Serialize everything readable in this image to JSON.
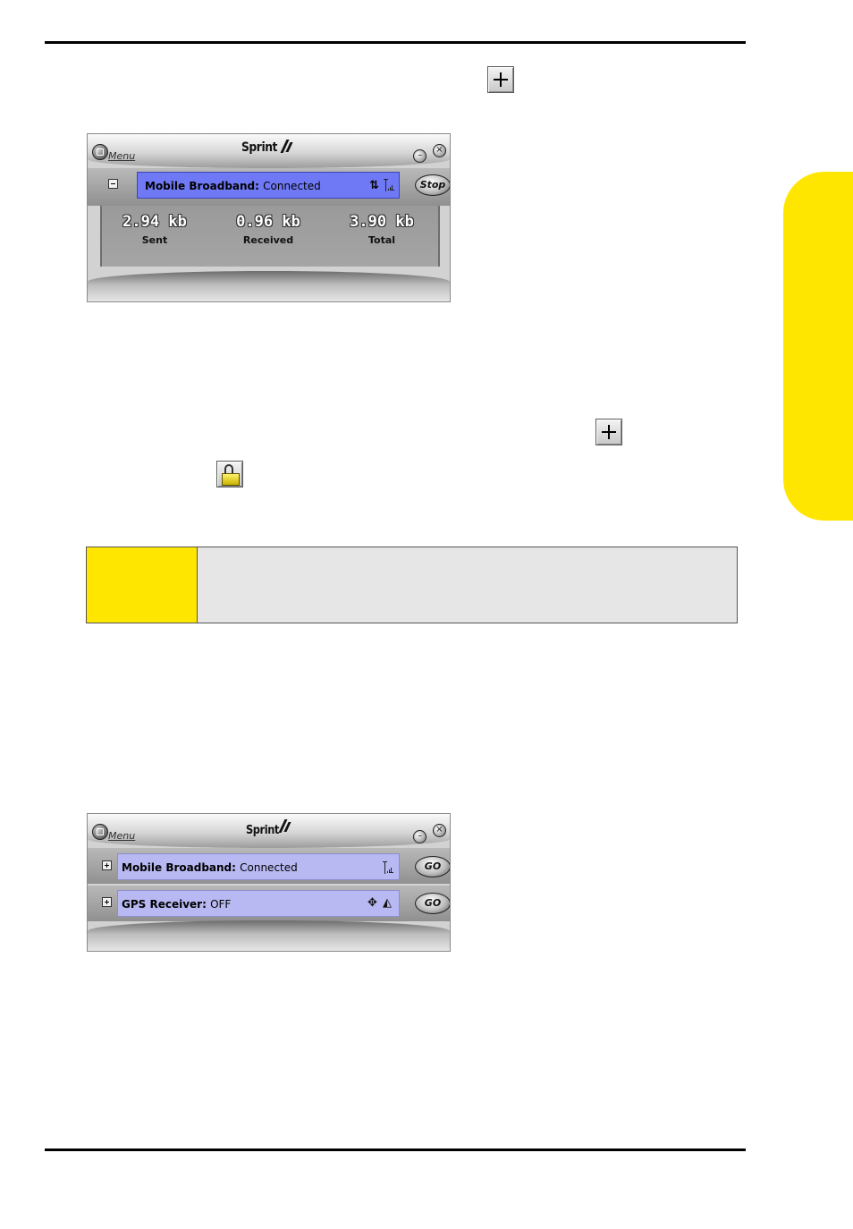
{
  "window_top": {
    "menu_label": "Menu",
    "brand": "Sprint",
    "connection": {
      "name": "Mobile Broadband:",
      "status": "Connected",
      "action": "Stop"
    },
    "stats": [
      {
        "value": "2.94 kb",
        "label": "Sent"
      },
      {
        "value": "0.96 kb",
        "label": "Received"
      },
      {
        "value": "3.90 kb",
        "label": "Total"
      }
    ]
  },
  "window_bottom": {
    "menu_label": "Menu",
    "brand": "Sprint",
    "connections": [
      {
        "name": "Mobile Broadband:",
        "status": "Connected",
        "action": "GO"
      },
      {
        "name": "GPS Receiver:",
        "status": "OFF",
        "action": "GO"
      }
    ]
  },
  "icons": [
    "expand-plus-icon",
    "lock-icon",
    "signal-icon",
    "data-arrows-icon",
    "gps-target-icon"
  ],
  "colors": {
    "accent_yellow": "#ffe600",
    "active_bar": "#6f79f5",
    "idle_bar": "#b8b8f2"
  }
}
